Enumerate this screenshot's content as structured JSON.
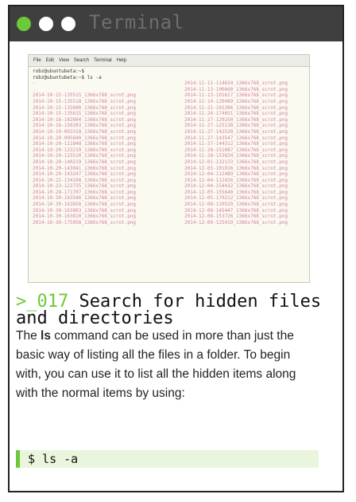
{
  "window": {
    "title": "Terminal"
  },
  "screenshot": {
    "menu": [
      "File",
      "Edit",
      "View",
      "Search",
      "Terminal",
      "Help"
    ],
    "prompt1": "robz@ubuntubeta:~$",
    "prompt2": "robz@ubuntubeta:~$ ls -a",
    "rows": [
      [
        "~",
        "2014-11-11-114634_1366x768_scrot.png"
      ],
      [
        "..",
        "2014-11-13-100660_1366x768_scrot.png"
      ],
      [
        "2014-10-15-135515_1366x768_scrot.png",
        "2014-11-13-101627_1366x768_scrot.png"
      ],
      [
        "2014-10-15-135518_1366x768_scrot.png",
        "2014-11-14-120489_1366x768_scrot.png"
      ],
      [
        "2014-10-15-135600_1366x768_scrot.png",
        "2014-11-21-101306_1366x768_scrot.png"
      ],
      [
        "2014-10-15-135615_1366x768_scrot.png",
        "2014-11-24-174031_1366x768_scrot.png"
      ],
      [
        "2014-10-16-102604_1366x768_scrot.png",
        "2014-11-27-120250_1366x768_scrot.png"
      ],
      [
        "2014-10-16-150203_1366x768_scrot.png",
        "2014-11-27-125138_1366x768_scrot.png"
      ],
      [
        "2014-10-19-093318_1366x768_scrot.png",
        "2014-11-27-142528_1366x768_scrot.png"
      ],
      [
        "2014-10-20-095600_1366x768_scrot.png",
        "2014-11-27-143547_1366x768_scrot.png"
      ],
      [
        "2014-10-20-111848_1366x768_scrot.png",
        "2014-11-27-144312_1366x768_scrot.png"
      ],
      [
        "2014-10-20-123219_1366x768_scrot.png",
        "2014-11-28-151087_1366x768_scrot.png"
      ],
      [
        "2014-10-20-125510_1366x768_scrot.png",
        "2014-11-28-153834_1366x768_scrot.png"
      ],
      [
        "2014-10-20-140219_1366x768_scrot.png",
        "2014-12-01-132133_1366x768_scrot.png"
      ],
      [
        "2014-10-20-143041_1366x768_scrot.png",
        "2014-12-03-101916_1366x768_scrot.png"
      ],
      [
        "2014-10-20-143247_1366x768_scrot.png",
        "2014-12-04-112489_1366x768_scrot.png"
      ],
      [
        "2014-10-22-134108_1366x768_scrot.png",
        "2014-12-04-112426_1366x768_scrot.png"
      ],
      [
        "2014-10-23-122735_1366x768_scrot.png",
        "2014-12-04-154432_1366x768_scrot.png"
      ],
      [
        "2014-10-28-171707_1366x768_scrot.png",
        "2014-12-05-155640_1366x768_scrot.png"
      ],
      [
        "2014-10-30-163546_1366x768_scrot.png",
        "2014-12-05-170212_1366x768_scrot.png"
      ],
      [
        "2014-10-30-163658_1366x768_scrot.png",
        "2014-12-08-120529_1366x768_scrot.png"
      ],
      [
        "2014-10-30-163803_1366x768_scrot.png",
        "2014-12-08-145447_1366x768_scrot.png"
      ],
      [
        "2014-10-30-163810_1366x768_scrot.png",
        "2014-12-08-153726_1366x768_scrot.png"
      ],
      [
        "2014-10-30-175058_1366x768_scrot.png",
        "2014-12-09-125419_1366x768_scrot.png"
      ]
    ]
  },
  "article": {
    "number": ">_017",
    "title": " Search for hidden files and directories",
    "body_pre": "The ",
    "body_cmd": "ls",
    "body_post": " command can be used in more than just the basic way of listing all the files in a folder. To begin with, you can use it to list all the hidden items along with the normal items by using:",
    "code": "$ ls -a"
  },
  "colors": {
    "accent_green": "#6cc93a",
    "titlebar": "#3f3f3f",
    "filename_pink": "#d17fa2"
  }
}
